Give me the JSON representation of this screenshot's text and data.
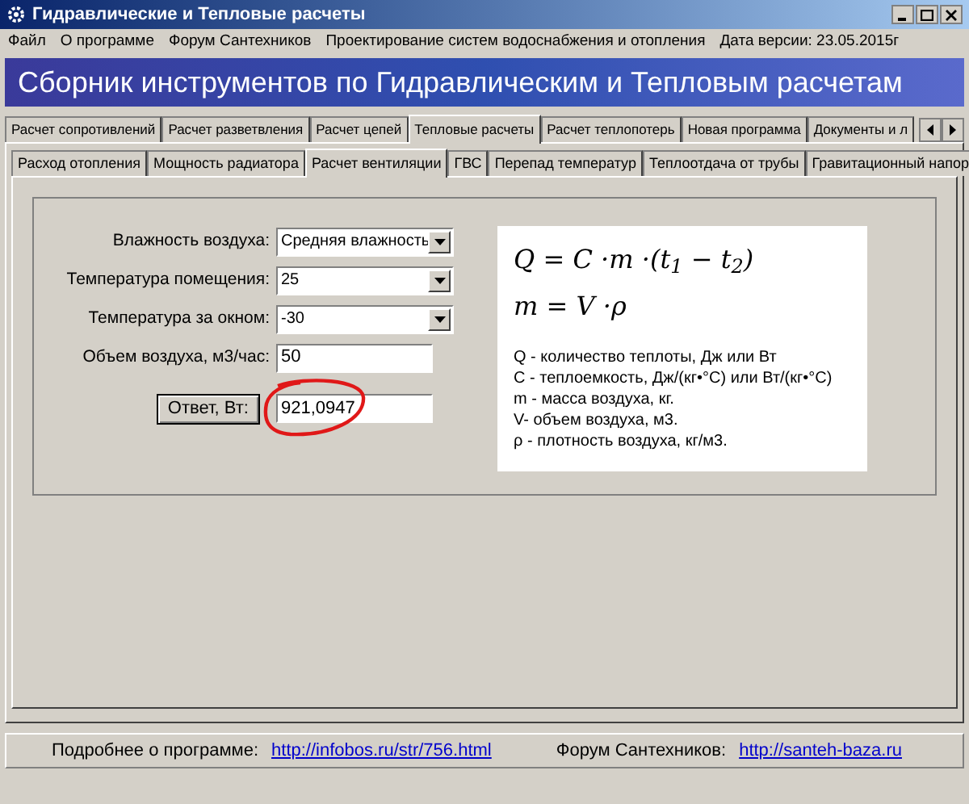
{
  "window": {
    "title": "Гидравлические и Тепловые расчеты"
  },
  "menu": [
    "Файл",
    "О программе",
    "Форум Сантехников",
    "Проектирование систем водоснабжения и отопления",
    "Дата версии: 23.05.2015г"
  ],
  "banner": "Сборник инструментов по Гидравлическим и Тепловым расчетам",
  "tabs": [
    {
      "label": "Расчет сопротивлений",
      "selected": false
    },
    {
      "label": "Расчет разветвления",
      "selected": false
    },
    {
      "label": "Расчет цепей",
      "selected": false
    },
    {
      "label": "Тепловые расчеты",
      "selected": true
    },
    {
      "label": "Расчет теплопотерь",
      "selected": false
    },
    {
      "label": "Новая программа",
      "selected": false
    },
    {
      "label": "Документы и л",
      "selected": false
    }
  ],
  "subtabs": [
    {
      "label": "Расход отопления",
      "selected": false
    },
    {
      "label": "Мощность радиатора",
      "selected": false
    },
    {
      "label": "Расчет вентиляции",
      "selected": true
    },
    {
      "label": "ГВС",
      "selected": false
    },
    {
      "label": "Перепад температур",
      "selected": false
    },
    {
      "label": "Теплоотдача от трубы",
      "selected": false
    },
    {
      "label": "Гравитационный напор",
      "selected": false
    }
  ],
  "fields": [
    {
      "label": "Влажность воздуха:",
      "kind": "dropdown",
      "value": "Средняя влажность"
    },
    {
      "label": "Температура помещения:",
      "kind": "dropdown",
      "value": "25"
    },
    {
      "label": "Температура за окном:",
      "kind": "dropdown",
      "value": "-30"
    },
    {
      "label": "Объем воздуха, м3/час:",
      "kind": "text",
      "value": "50"
    }
  ],
  "answer": {
    "button": "Ответ, Вт:",
    "value": "921,0947",
    "circled": true
  },
  "formula": {
    "equations": [
      "Q = C ·m ·(t$_{1}$ − t$_{2}$)",
      "m = V ·ρ"
    ],
    "legend": [
      "Q - количество теплоты, Дж или Вт",
      "C - теплоемкость, Дж/(кг•°С) или Вт/(кг•°С)",
      "m - масса воздуха, кг.",
      "V- объем воздуха, м3.",
      "ρ - плотность воздуха, кг/м3."
    ]
  },
  "status_bar": [
    {
      "label": "Подробнее о программе:",
      "link": "http://infobos.ru/str/756.html"
    },
    {
      "label": "Форум Сантехников:",
      "link": "http://santeh-baza.ru"
    }
  ]
}
